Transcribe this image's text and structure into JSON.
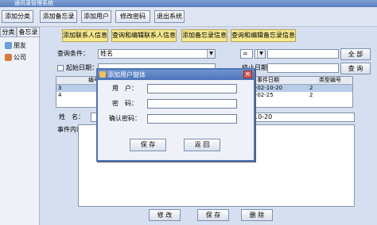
{
  "window": {
    "title": "通讯录管理系统"
  },
  "toolbar": {
    "buttons": [
      "添加分类",
      "添加备忘录",
      "添加用户",
      "修改密码",
      "退出系统"
    ]
  },
  "left": {
    "tabs": [
      "分类",
      "备忘录"
    ],
    "items": [
      "朋友",
      "公司"
    ]
  },
  "subtabs": [
    "添加联系人信息",
    "查询和编辑联系人信息",
    "添加备忘录信息",
    "查询和编辑备忘录信息"
  ],
  "query": {
    "condition_label": "查询条件：",
    "condition_value": "姓名",
    "operator_value": "=",
    "all_button": "全 部",
    "query_button": "查 询",
    "start_date_label": "起始日期：",
    "end_date_label": "终止日期："
  },
  "table": {
    "headers": [
      "编号",
      "事件日期",
      "类型编号"
    ],
    "rows": [
      [
        "3",
        "2009-02-10-20",
        "2"
      ],
      [
        "4",
        "2009-02-25",
        "2"
      ]
    ]
  },
  "detail": {
    "name_label": "姓　名：",
    "content_label": "事件内容：",
    "date_value": "10-20"
  },
  "actions": [
    "修 改",
    "保 存",
    "删 除"
  ],
  "dialog": {
    "title": "添加用户窗体",
    "user_label": "用　户：",
    "password_label": "密　码：",
    "confirm_label": "确认密码：",
    "save_button": "保 存",
    "back_button": "返 回",
    "close_glyph": "✕"
  }
}
